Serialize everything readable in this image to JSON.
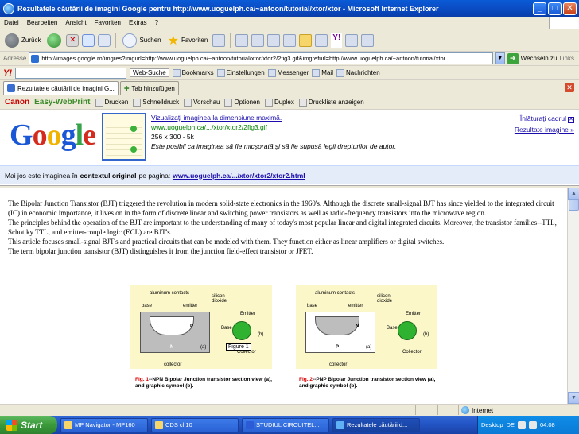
{
  "window": {
    "title": "Rezultatele căutării de imagini Google pentru http://www.uoguelph.ca/~antoon/tutorial/xtor/xtor - Microsoft Internet Explorer",
    "min": "_",
    "max": "□",
    "close": "✕"
  },
  "menubar": [
    "Datei",
    "Bearbeiten",
    "Ansicht",
    "Favoriten",
    "Extras",
    "?"
  ],
  "toolbar": {
    "back": "Zurück",
    "search": "Suchen",
    "favorites": "Favoriten"
  },
  "address": {
    "label": "Adresse",
    "url": "http://images.google.ro/imgres?imgurl=http://www.uoguelph.ca/~antoon/tutorial/xtor/xtor2/2fig3.gif&imgrefurl=http://www.uoguelph.ca/~antoon/tutorial/xtor",
    "go": "Wechseln zu",
    "links": "Links"
  },
  "yahoo": {
    "logo": "Y!",
    "websuche": "Web-Suche",
    "bookmarks": "Bookmarks",
    "settings": "Einstellungen",
    "messenger": "Messenger",
    "mail": "Mail",
    "news": "Nachrichten"
  },
  "tabs": {
    "active": "Rezultatele căutării de imagini G...",
    "new": "Tab hinzufügen"
  },
  "canon": {
    "logo": "Canon",
    "ewp": "Easy-WebPrint",
    "items": [
      "Drucken",
      "Schnelldruck",
      "Vorschau",
      "Optionen",
      "Duplex",
      "Druckliste anzeigen"
    ]
  },
  "google": {
    "logo": [
      "G",
      "o",
      "o",
      "g",
      "l",
      "e"
    ],
    "view_full": "Vizualizaţi imaginea la dimensiune maximă.",
    "source_url": "www.uoguelph.ca/.../xtor/xtor2/2fig3.gif",
    "size": "256 x 300 - 5k",
    "notice": "Este posibil ca imaginea să fie micşorată şi să fie supusă legii drepturilor de autor.",
    "back_top": "Înlăturaţi cadrul",
    "results": "Rezultate imagine »",
    "context_prefix": "Mai jos este imaginea în",
    "context_bold": "contextul original",
    "context_mid": "pe pagina:",
    "context_link": "www.uoguelph.ca/.../xtor/xtor2/xtor2.html"
  },
  "article": {
    "paragraphs": [
      "The Bipolar Junction Transistor (BJT) triggered the revolution in modern solid-state electronics in the 1960's. Although the discrete small-signal BJT has since yielded to the integrated circuit (IC) in economic importance, it lives on in the form of discrete linear and switching power transistors as well as radio-frequency transistors into the microwave region.",
      "The principles behind the operation of the BJT are important to the understanding of many of today's most popular linear and digital integrated circuits. Moreover, the transistor families--TTL, Schottky TTL, and emitter-couple logic (ECL) are BJT's.",
      "This article focuses small-signal BJT's and practical circuits that can be modeled with them. They function either as linear amplifiers or digital switches.",
      "The term bipolar junction transistor (BJT) distinguishes it from the junction field-effect transistor or JFET."
    ]
  },
  "figures": {
    "npn": {
      "aluminum": "aluminum contacts",
      "silicon": "silicon dioxide",
      "base": "base",
      "emitter": "emitter",
      "collector": "collector",
      "Emitter": "Emitter",
      "Base": "Base",
      "Collector": "Collector",
      "a": "(a)",
      "b": "(b)",
      "N": "N",
      "P": "P",
      "cap_fig": "Fig. 1",
      "cap_rest": "--NPN Bipolar Junction transistor section view (a), and graphic symbol (b).",
      "tooltip": "Figure 1"
    },
    "pnp": {
      "aluminum": "aluminum contacts",
      "silicon": "silicon dioxide",
      "base": "base",
      "emitter": "emitter",
      "collector": "collector",
      "Emitter": "Emitter",
      "Base": "Base",
      "Collector": "Collector",
      "a": "(a)",
      "b": "(b)",
      "N": "N",
      "P": "P",
      "cap_fig": "Fig. 2",
      "cap_rest": "--PNP Bipolar Junction transistor section view (a), and graphic symbol (b)."
    }
  },
  "status": {
    "zone": "Internet"
  },
  "taskbar": {
    "start": "Start",
    "tasks": [
      "MP Navigator - MP160",
      "CDS cl 10",
      "STUDIUL CIRCUITEL...",
      "Rezultatele căutării d..."
    ],
    "desktop": "Desktop",
    "lang": "DE",
    "clock": "04:08"
  }
}
